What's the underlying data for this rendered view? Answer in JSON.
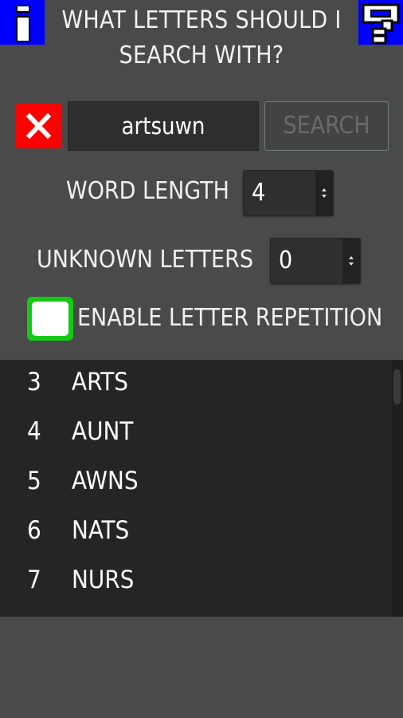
{
  "header": {
    "title_line1": "WHAT LETTERS SHOULD I",
    "title_line2": "SEARCH WITH?",
    "info_icon": "info-icon",
    "help_icon": "help-icon"
  },
  "search": {
    "input_value": "artsuwn",
    "button_label": "SEARCH",
    "clear_icon": "close-icon"
  },
  "word_length": {
    "label": "WORD LENGTH",
    "value": "4"
  },
  "unknown_letters": {
    "label": "UNKNOWN LETTERS",
    "value": "0"
  },
  "repetition": {
    "label": "ENABLE LETTER REPETITION",
    "checked": false
  },
  "results": [
    {
      "num": "3",
      "word": "ARTS"
    },
    {
      "num": "4",
      "word": "AUNT"
    },
    {
      "num": "5",
      "word": "AWNS"
    },
    {
      "num": "6",
      "word": "NATS"
    },
    {
      "num": "7",
      "word": "NURS"
    }
  ],
  "colors": {
    "background": "#4a4a4a",
    "icon_blue": "#0000ff",
    "clear_red": "#ff0000",
    "checkbox_green": "#16c916",
    "list_bg": "#252525"
  }
}
